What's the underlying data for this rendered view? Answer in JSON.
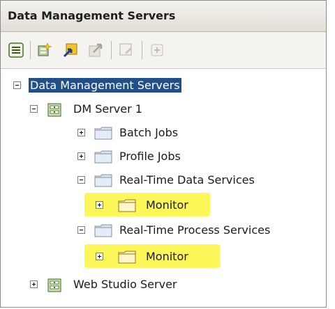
{
  "panel": {
    "title": "Data Management Servers"
  },
  "toolbar": {
    "buttons": [
      {
        "icon": "properties-icon"
      },
      {
        "icon": "new-server-icon"
      },
      {
        "icon": "import-icon"
      },
      {
        "icon": "export-icon"
      },
      {
        "icon": "edit-icon"
      },
      {
        "icon": "add-icon"
      }
    ]
  },
  "tree": {
    "root": "Data Management Servers",
    "server1": "DM Server 1",
    "batch_jobs": "Batch Jobs",
    "profile_jobs": "Profile Jobs",
    "rt_data_services": "Real-Time Data Services",
    "monitor_1": "Monitor",
    "rt_process_services": "Real-Time Process Services",
    "monitor_2": "Monitor",
    "web_studio": "Web Studio Server"
  },
  "colors": {
    "selection": "#214f8a",
    "highlight": "#fef75a",
    "folder_blue": "#d6e4f5",
    "folder_yellow": "#fff4b0"
  }
}
